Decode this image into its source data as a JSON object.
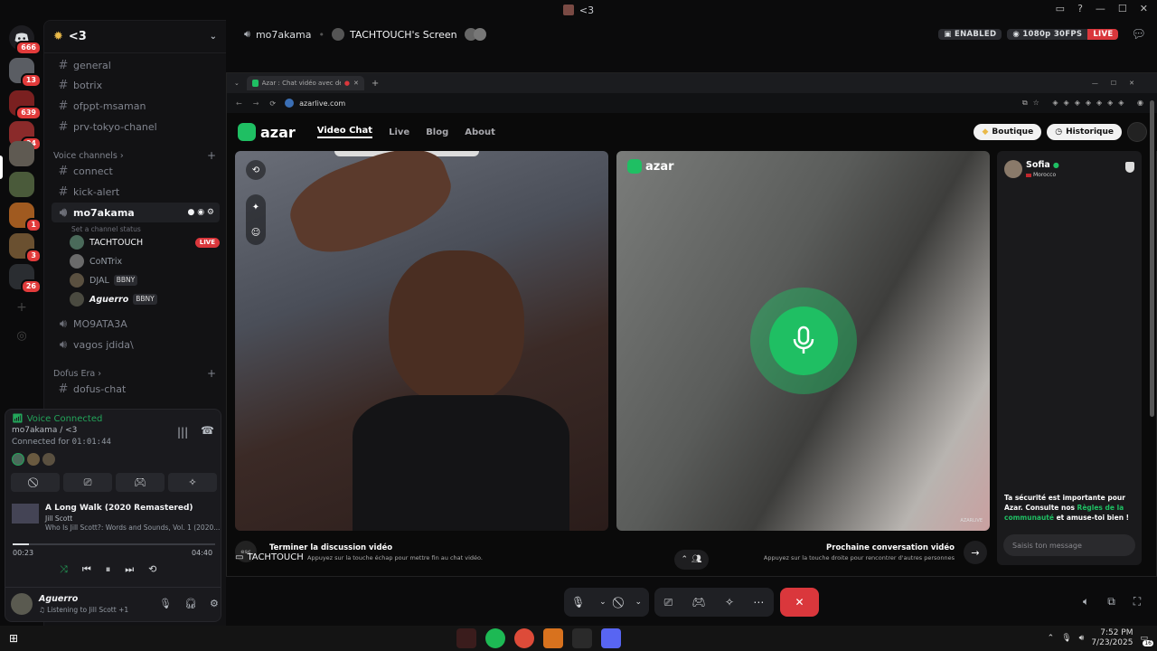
{
  "window": {
    "title": "<3"
  },
  "servers": [
    {
      "name": "discord-home",
      "badge": "666"
    },
    {
      "name": "server-2",
      "badge": "13"
    },
    {
      "name": "server-3",
      "badge": "639"
    },
    {
      "name": "server-4",
      "badge": "94"
    },
    {
      "name": "server-5",
      "badge": ""
    },
    {
      "name": "server-6",
      "badge": ""
    },
    {
      "name": "server-7",
      "badge": "1"
    },
    {
      "name": "server-8",
      "badge": "3"
    },
    {
      "name": "server-9",
      "badge": "26"
    }
  ],
  "sidebar": {
    "server_name": "<3",
    "text_channels": [
      "general",
      "botrix",
      "ofppt-msaman",
      "prv-tokyo-chanel"
    ],
    "voice_category": "Voice channels",
    "voice_channels": [
      "connect",
      "kick-alert"
    ],
    "active_voice": {
      "name": "mo7akama",
      "status_hint": "Set a channel status",
      "users": [
        {
          "name": "TACHTOUCH",
          "tag": "",
          "live": "LIVE"
        },
        {
          "name": "CoNTrix",
          "tag": "",
          "live": ""
        },
        {
          "name": "DJAL",
          "tag": "BBNY",
          "live": ""
        },
        {
          "name": "Aguerro",
          "tag": "BBNY",
          "live": ""
        }
      ]
    },
    "more_voice": [
      "MO9ATA3A",
      "vagos jdida\\"
    ],
    "dofus_category": "Dofus Era",
    "dofus_channels": [
      "dofus-chat"
    ]
  },
  "voice_panel": {
    "status": "Voice Connected",
    "channel": "mo7akama / <3",
    "connected_label": "Connected for",
    "connected_time": "01:01:44",
    "song_title": "A Long Walk (2020 Remastered)",
    "artist": "Jill Scott",
    "album": "Who Is Jill Scott?: Words and Sounds, Vol. 1 (2020...",
    "elapsed": "00:23",
    "total": "04:40",
    "progress": 0.08
  },
  "user": {
    "name": "Aguerro",
    "activity": "Listening to Jill Scott +1"
  },
  "stage": {
    "channel": "mo7akama",
    "screen": "TACHTOUCH's Screen",
    "enabled": "ENABLED",
    "quality": "1080p 30FPS",
    "live": "LIVE",
    "streamer": "TACHTOUCH"
  },
  "browser": {
    "tab_title": "Azar : Chat vidéo avec de n...",
    "url": "azarlive.com"
  },
  "azar": {
    "logo": "azar",
    "nav": [
      "Video Chat",
      "Live",
      "Blog",
      "About"
    ],
    "boutique": "Boutique",
    "historique": "Historique",
    "partner_name": "Sofia",
    "partner_country": "Morocco",
    "safety_text_1": "Ta sécurité est importante pour Azar. Consulte nos ",
    "safety_link": "Règles de la communauté",
    "safety_text_2": " et amuse-toi bien !",
    "message_placeholder": "Saisis ton message",
    "end_key": "esc",
    "end_title": "Terminer la discussion vidéo",
    "end_hint": "Appuyez sur la touche échap pour mettre fin au chat vidéo.",
    "next_title": "Prochaine conversation vidéo",
    "next_hint": "Appuyez sur la touche droite pour rencontrer d'autres personnes",
    "watermark": "azar"
  },
  "taskbar": {
    "time": "7:52 PM",
    "date": "7/23/2025",
    "notif": "16"
  },
  "colors": {
    "accent_green": "#1fbf63",
    "live_red": "#da373c",
    "leave_red": "#da373c"
  }
}
